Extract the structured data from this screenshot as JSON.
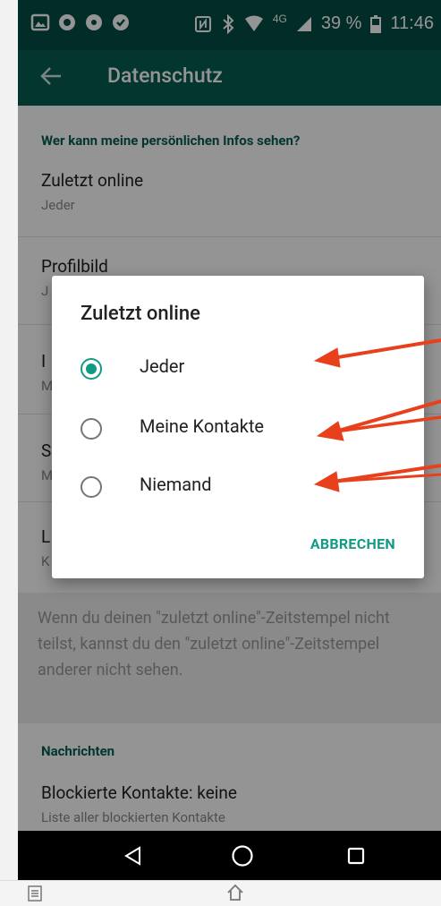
{
  "status_bar": {
    "battery": "39 %",
    "time": "11:46",
    "network": "4G",
    "left_icons": [
      "gallery-icon",
      "chrome-icon",
      "record-icon",
      "sync-icon"
    ],
    "right_icons": [
      "nfc-icon",
      "bluetooth-icon",
      "wifi-icon",
      "signal-icon",
      "battery-icon"
    ]
  },
  "app_bar": {
    "title": "Datenschutz",
    "back_icon": "back-arrow-icon"
  },
  "privacy": {
    "section_title": "Wer kann meine persönlichen Infos sehen?",
    "items": [
      {
        "title": "Zuletzt online",
        "subtitle": "Jeder"
      },
      {
        "title": "Profilbild",
        "subtitle": "J"
      },
      {
        "title": "I",
        "subtitle": "M"
      },
      {
        "title": "S",
        "subtitle": "M"
      },
      {
        "title": "L",
        "subtitle": "K"
      }
    ],
    "info_text": "Wenn du deinen \"zuletzt online\"-Zeitstempel nicht teilst, kannst du den \"zuletzt online\"-Zeitstempel anderer nicht sehen."
  },
  "messages": {
    "section_title": "Nachrichten",
    "blocked_title": "Blockierte Kontakte: keine",
    "blocked_subtitle": "Liste aller blockierten Kontakte"
  },
  "dialog": {
    "title": "Zuletzt online",
    "options": [
      {
        "label": "Jeder",
        "selected": true
      },
      {
        "label": "Meine Kontakte",
        "selected": false
      },
      {
        "label": "Niemand",
        "selected": false
      }
    ],
    "cancel_label": "ABBRECHEN"
  },
  "nav_bar": {
    "icons": [
      "back-triangle-icon",
      "home-circle-icon",
      "recents-square-icon"
    ]
  },
  "colors": {
    "status_bar": "#054d44",
    "app_bar": "#075e54",
    "accent": "#129a84",
    "annotation_arrow": "#e8401c"
  }
}
